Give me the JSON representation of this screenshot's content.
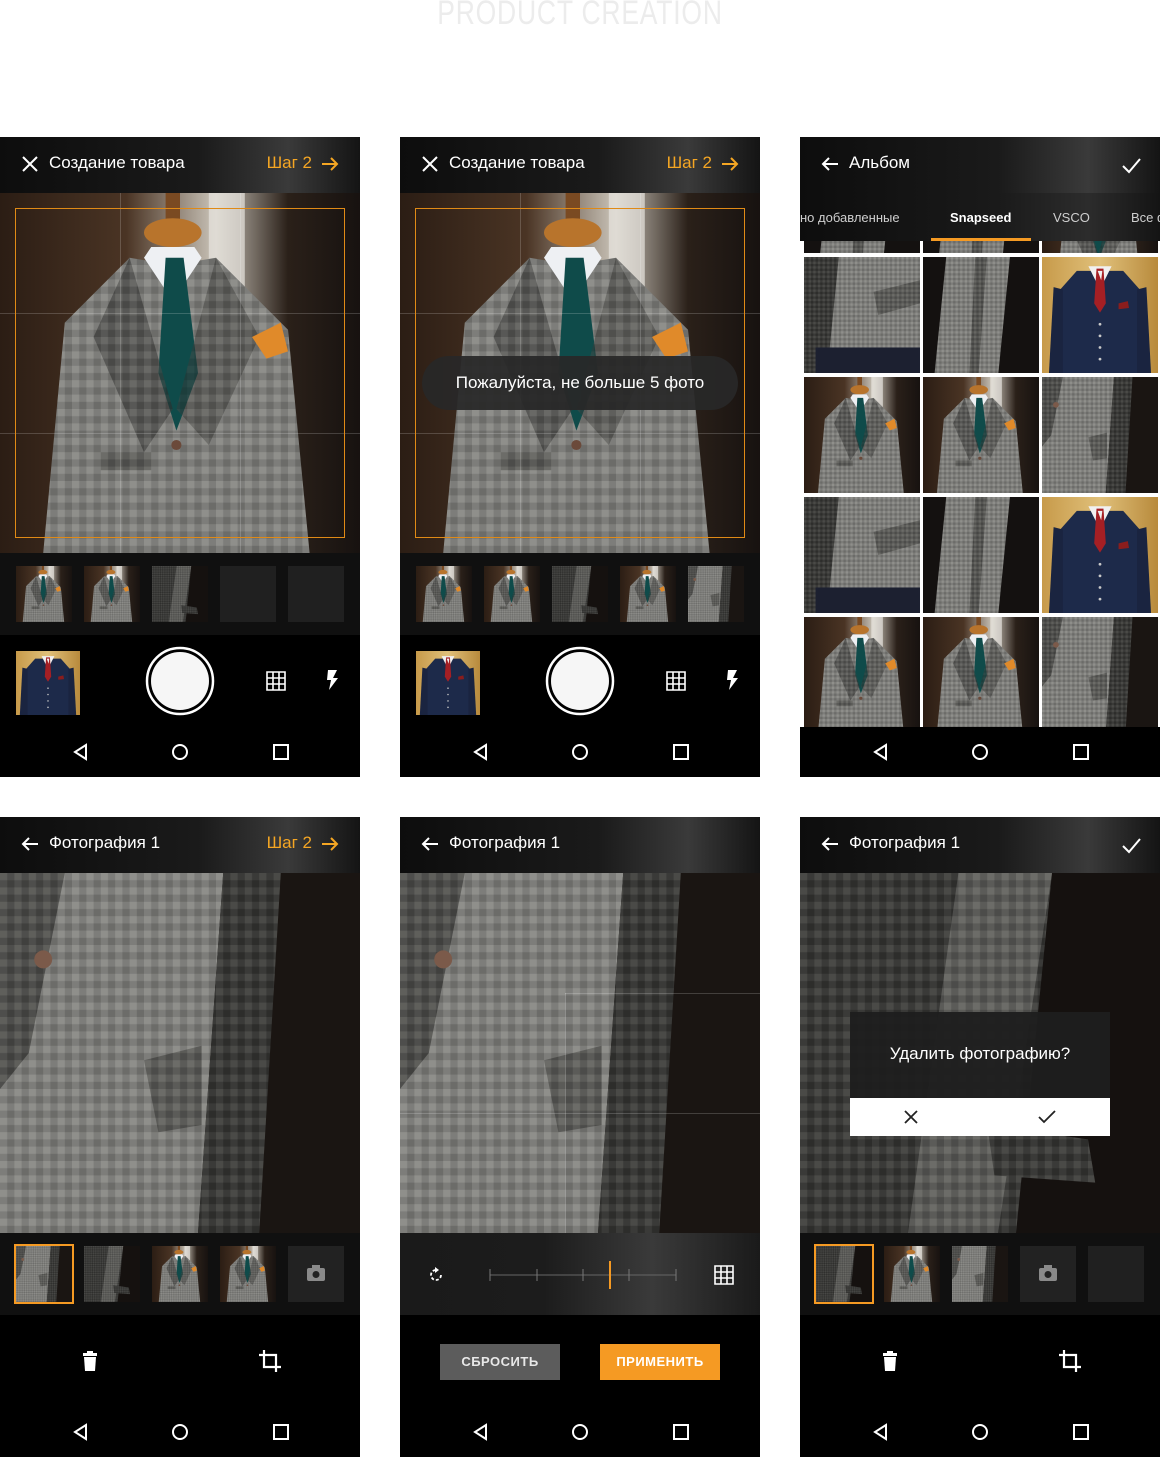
{
  "page": {
    "heading": "PRODUCT CREATION"
  },
  "screens": {
    "s1": {
      "title": "Создание товара",
      "step": "Шаг 2"
    },
    "s2": {
      "title": "Создание товара",
      "step": "Шаг 2",
      "toast": "Пожалуйста, не больше 5 фото"
    },
    "s3": {
      "title": "Альбом",
      "tabs": [
        "но добавленные",
        "Snapseed",
        "VSCO",
        "Все ф"
      ],
      "active_tab": "Snapseed"
    },
    "s4": {
      "title": "Фотография 1",
      "step": "Шаг 2"
    },
    "s5": {
      "title": "Фотография 1",
      "reset": "СБРОСИТЬ",
      "apply": "ПРИМЕНИТЬ"
    },
    "s6": {
      "title": "Фотография 1",
      "dialog": "Удалить фотографию?"
    }
  },
  "colors": {
    "accent": "#f59a23",
    "bar": "#1a1a1a",
    "background": "#000000"
  },
  "icons": [
    "close-icon",
    "arrow-right-icon",
    "arrow-left-icon",
    "check-icon",
    "grid-icon",
    "flash-icon",
    "trash-icon",
    "crop-icon",
    "rotate-icon",
    "camera-icon",
    "nav-back-icon",
    "nav-home-icon",
    "nav-recents-icon"
  ]
}
